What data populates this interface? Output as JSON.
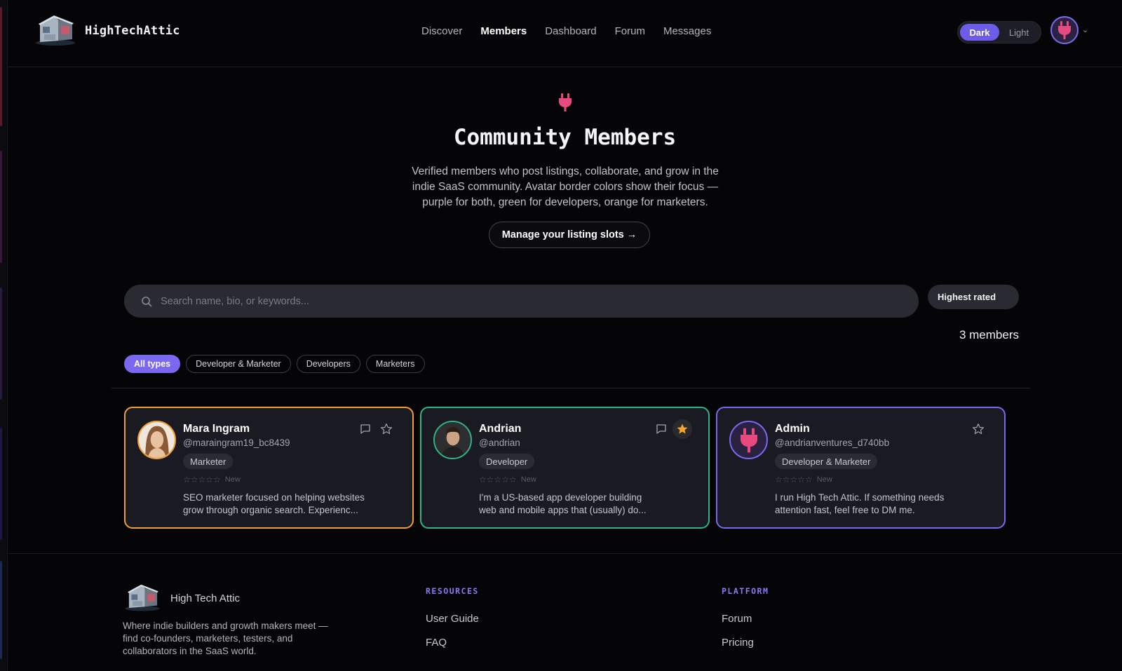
{
  "header": {
    "brand": "HighTechAttic",
    "nav": [
      "Discover",
      "Members",
      "Dashboard",
      "Forum",
      "Messages"
    ],
    "active_nav": "Members",
    "theme": {
      "dark": "Dark",
      "light": "Light",
      "selected": "Dark"
    }
  },
  "hero": {
    "title": "Community Members",
    "subtitle": "Verified members who post listings, collaborate, and grow in the indie SaaS community. Avatar border colors show their focus — purple for both, green for developers, orange for marketers.",
    "cta": "Manage your listing slots →"
  },
  "search": {
    "placeholder": "Search name, bio, or keywords...",
    "value": "",
    "sort": "Highest rated"
  },
  "count": "3 members",
  "filters": [
    "All types",
    "Developer & Marketer",
    "Developers",
    "Marketers"
  ],
  "active_filter": "All types",
  "colors": {
    "accent": "#7b68f0",
    "marketer": "#f0a030",
    "developer": "#2fb585",
    "both": "#7b68f0",
    "brand_pink": "#e84a7f",
    "star_active": "#f5a623"
  },
  "members": [
    {
      "name": "Mara Ingram",
      "handle": "@maraingram19_bc8439",
      "role": "Marketer",
      "rating_label": "New",
      "bio_line1": "SEO marketer focused on helping websites",
      "bio_line2": "grow through organic search. Experienc...",
      "favorited": false,
      "has_message": true,
      "avatar": "portrait-photo"
    },
    {
      "name": "Andrian",
      "handle": "@andrian",
      "role": "Developer",
      "rating_label": "New",
      "bio_line1": "I'm a US-based app developer building",
      "bio_line2": "web and mobile apps that (usually) do...",
      "favorited": true,
      "has_message": true,
      "avatar": "portrait-photo"
    },
    {
      "name": "Admin",
      "handle": "@andrianventures_d740bb",
      "role": "Developer & Marketer",
      "rating_label": "New",
      "bio_line1": "I run High Tech Attic. If something needs",
      "bio_line2": "attention fast, feel free to DM me.",
      "favorited": false,
      "has_message": false,
      "avatar": "plug-icon"
    }
  ],
  "footer": {
    "brand": "High Tech Attic",
    "description": "Where indie builders and growth makers meet — find co-founders, marketers, testers, and collaborators in the SaaS world.",
    "resources": {
      "heading": "RESOURCES",
      "links": [
        "User Guide",
        "FAQ"
      ]
    },
    "platform": {
      "heading": "PLATFORM",
      "links": [
        "Forum",
        "Pricing"
      ]
    }
  }
}
